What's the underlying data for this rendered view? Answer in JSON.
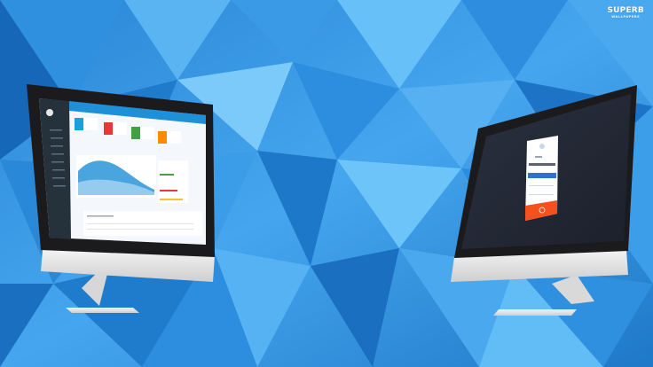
{
  "watermark": {
    "line1": "SUPERB",
    "line2": "WALLPAPERS"
  },
  "scene": {
    "background_colors": [
      "#1f7ed0",
      "#2f96e3",
      "#49a9ef",
      "#1b6fbf",
      "#6bc0f6",
      "#0f5aa8"
    ],
    "monitor_frame_color": "#1b1b1d",
    "monitor_stand_color": "#e6e6e6",
    "dashboard_accent": "#1f90d8",
    "login_button_color": "#f4511e"
  },
  "left_monitor": {
    "screen_type": "admin dashboard",
    "stat_tile_colors": [
      "#1aa0dc",
      "#e53935",
      "#43a047",
      "#fb8c00"
    ]
  },
  "right_monitor": {
    "screen_type": "login form"
  }
}
